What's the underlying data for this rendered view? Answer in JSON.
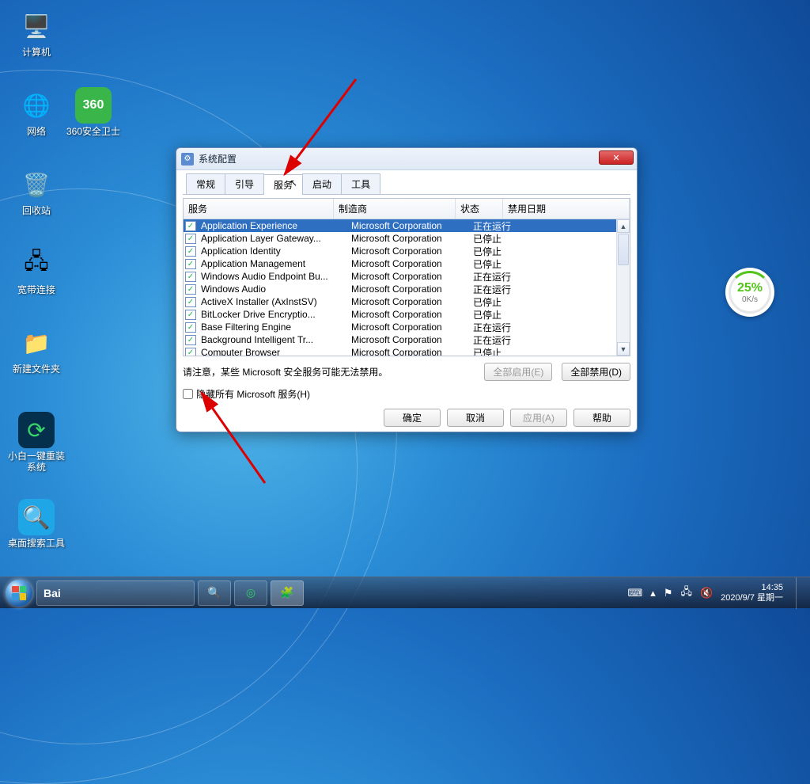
{
  "desktop": {
    "computer": "计算机",
    "network": "网络",
    "security_360": "360安全卫士",
    "recycle": "回收站",
    "broadband": "宽带连接",
    "new_folder": "新建文件夹",
    "reinstaller": "小白一键重装系统",
    "search_tool": "桌面搜索工具"
  },
  "widget": {
    "percent": "25%",
    "speed": "0K/s"
  },
  "window": {
    "title": "系统配置",
    "tabs": {
      "general": "常规",
      "boot": "引导",
      "services": "服务",
      "startup": "启动",
      "tools": "工具"
    },
    "columns": {
      "service": "服务",
      "manufacturer": "制造商",
      "status": "状态",
      "date_disabled": "禁用日期"
    },
    "rows": [
      {
        "svc": "Application Experience",
        "mfr": "Microsoft Corporation",
        "st": "正在运行",
        "sel": true
      },
      {
        "svc": "Application Layer Gateway...",
        "mfr": "Microsoft Corporation",
        "st": "已停止"
      },
      {
        "svc": "Application Identity",
        "mfr": "Microsoft Corporation",
        "st": "已停止"
      },
      {
        "svc": "Application Management",
        "mfr": "Microsoft Corporation",
        "st": "已停止"
      },
      {
        "svc": "Windows Audio Endpoint Bu...",
        "mfr": "Microsoft Corporation",
        "st": "正在运行"
      },
      {
        "svc": "Windows Audio",
        "mfr": "Microsoft Corporation",
        "st": "正在运行"
      },
      {
        "svc": "ActiveX Installer (AxInstSV)",
        "mfr": "Microsoft Corporation",
        "st": "已停止"
      },
      {
        "svc": "BitLocker Drive Encryptio...",
        "mfr": "Microsoft Corporation",
        "st": "已停止"
      },
      {
        "svc": "Base Filtering Engine",
        "mfr": "Microsoft Corporation",
        "st": "正在运行"
      },
      {
        "svc": "Background Intelligent Tr...",
        "mfr": "Microsoft Corporation",
        "st": "正在运行"
      },
      {
        "svc": "Computer Browser",
        "mfr": "Microsoft Corporation",
        "st": "已停止"
      }
    ],
    "note": "请注意，某些 Microsoft 安全服务可能无法禁用。",
    "enable_all": "全部启用(E)",
    "disable_all": "全部禁用(D)",
    "hide_ms": "隐藏所有 Microsoft 服务(H)",
    "ok": "确定",
    "cancel": "取消",
    "apply": "应用(A)",
    "help": "帮助"
  },
  "tray": {
    "time": "14:35",
    "date": "2020/9/7 星期一"
  }
}
